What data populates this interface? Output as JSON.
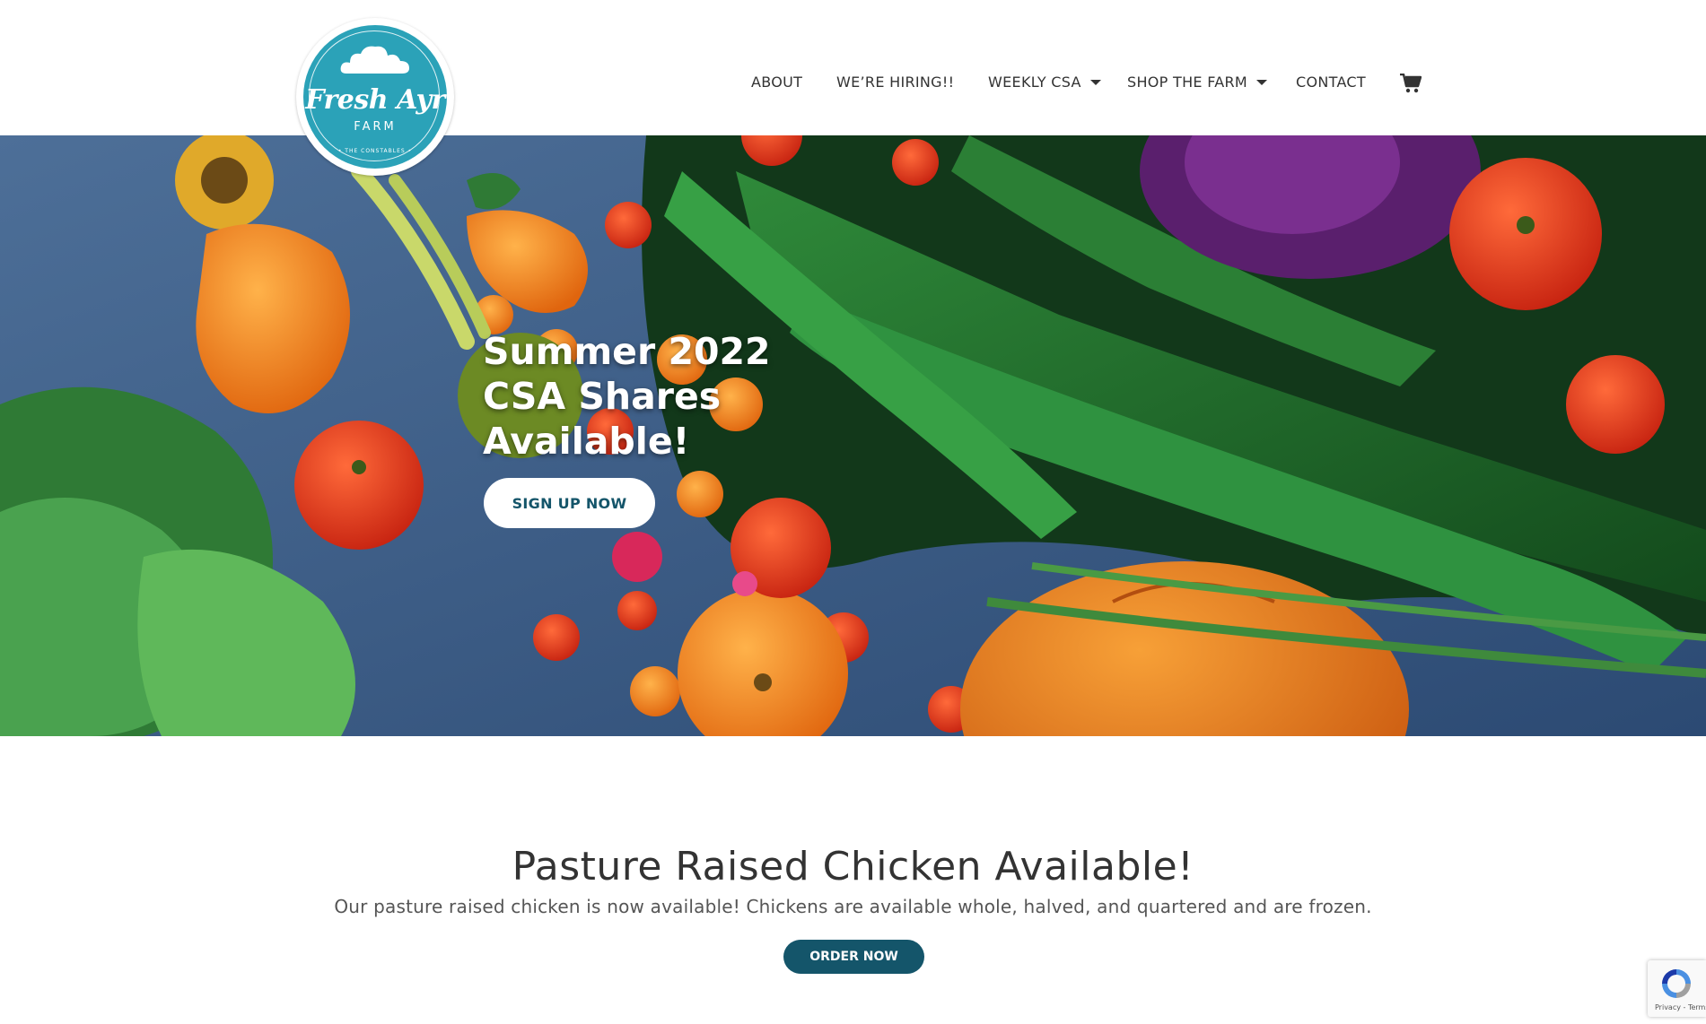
{
  "brand": {
    "logo_name": "Fresh Ayr",
    "logo_farm": "FARM",
    "logo_tagline": "• THE CONSTABLES •"
  },
  "nav": {
    "items": [
      {
        "label": "ABOUT",
        "has_dropdown": false
      },
      {
        "label": "WE’RE HIRING!!",
        "has_dropdown": false
      },
      {
        "label": "WEEKLY CSA",
        "has_dropdown": true
      },
      {
        "label": "SHOP THE FARM",
        "has_dropdown": true
      },
      {
        "label": "CONTACT",
        "has_dropdown": false
      }
    ],
    "cart_icon": "shopping-cart-icon"
  },
  "hero": {
    "title": "Summer 2022 CSA Shares Available!",
    "button_label": "SIGN UP NOW"
  },
  "chicken": {
    "title": "Pasture Raised Chicken Available!",
    "text": "Our pasture raised chicken is now available! Chickens are available whole, halved, and quartered and are frozen.",
    "button_label": "ORDER NOW"
  },
  "recaptcha": {
    "text": "Privacy - Terms"
  },
  "colors": {
    "accent": "#14556a",
    "logo_teal": "#2ba2b8"
  }
}
